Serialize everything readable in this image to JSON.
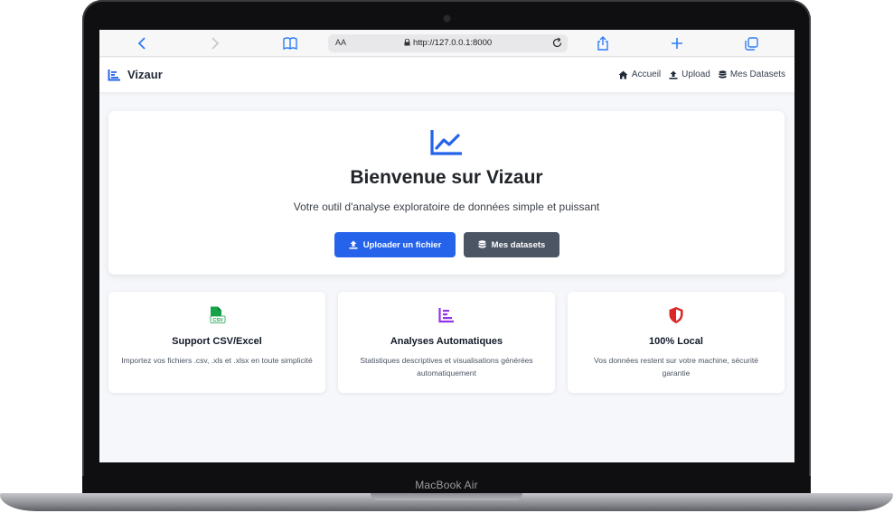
{
  "device": {
    "label": "MacBook Air"
  },
  "browser": {
    "url": "http://127.0.0.1:8000",
    "text_size_label": "AA"
  },
  "nav": {
    "brand": "Vizaur",
    "links": [
      {
        "label": "Accueil",
        "icon": "home-icon"
      },
      {
        "label": "Upload",
        "icon": "upload-icon"
      },
      {
        "label": "Mes Datasets",
        "icon": "database-icon"
      }
    ]
  },
  "hero": {
    "icon": "chart-line-icon",
    "title": "Bienvenue sur Vizaur",
    "subtitle": "Votre outil d'analyse exploratoire de données simple et puissant",
    "primary_button": "Uploader un fichier",
    "secondary_button": "Mes datasets"
  },
  "features": [
    {
      "icon": "file-csv-icon",
      "title": "Support CSV/Excel",
      "description": "Importez vos fichiers .csv, .xls et .xlsx en toute simplicité"
    },
    {
      "icon": "chart-bar-icon",
      "title": "Analyses Automatiques",
      "description": "Statistiques descriptives et visualisations générées automatiquement"
    },
    {
      "icon": "shield-icon",
      "title": "100% Local",
      "description": "Vos données restent sur votre machine, sécurité garantie"
    }
  ],
  "colors": {
    "primary": "#2563eb",
    "secondary": "#4b5563",
    "csv_green": "#16a34a",
    "purple": "#9333ea",
    "red": "#dc2626"
  }
}
